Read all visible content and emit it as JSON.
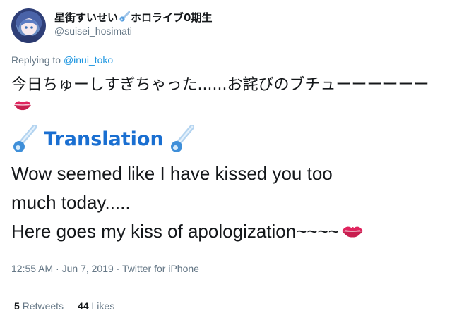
{
  "user": {
    "display_name_prefix": "星街すいせい",
    "display_name_suffix": "ホロライブ0期生",
    "handle": "@suisei_hosimati",
    "avatar_icon": "avatar-image"
  },
  "reply": {
    "prefix": "Replying to ",
    "mention": "@inui_toko"
  },
  "tweet": {
    "text": "今日ちゅーしすぎちゃった......お詫びのブチューーーーーー",
    "emoji": "kiss-mark-icon"
  },
  "translation": {
    "label": "Translation",
    "icon": "comet-icon",
    "lines": [
      "Wow seemed like I have kissed you too",
      "much today.....",
      "Here goes my kiss of apologization~~~~"
    ]
  },
  "meta": {
    "time": "12:55 AM",
    "date": "Jun 7, 2019",
    "source": "Twitter for iPhone",
    "separator": " · "
  },
  "stats": {
    "retweets_count": "5",
    "retweets_label": "Retweets",
    "likes_count": "44",
    "likes_label": "Likes"
  },
  "colors": {
    "link": "#1b95e0",
    "translation": "#1a6fd1",
    "muted": "#657786",
    "kiss": "#e0245e"
  }
}
